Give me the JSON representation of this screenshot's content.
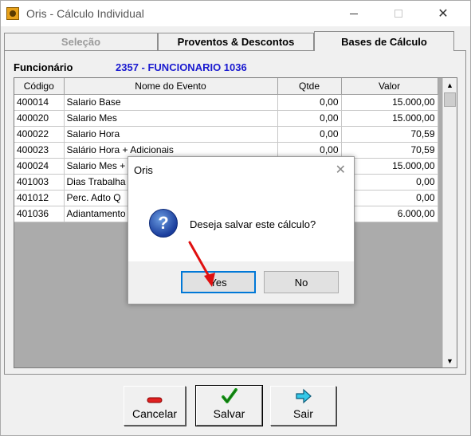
{
  "window": {
    "title": "Oris - Cálculo Individual",
    "close_glyph": "✕"
  },
  "tabs": [
    {
      "label": "Seleção",
      "state": "disabled"
    },
    {
      "label": "Proventos & Descontos",
      "state": "normal"
    },
    {
      "label": "Bases de Cálculo",
      "state": "active"
    }
  ],
  "employee": {
    "label": "Funcionário",
    "value": "2357 - FUNCIONARIO 1036"
  },
  "grid": {
    "columns": [
      "Código",
      "Nome do Evento",
      "Qtde",
      "Valor"
    ],
    "rows": [
      {
        "codigo": "400014",
        "nome": "Salario Base",
        "qtde": "0,00",
        "valor": "15.000,00"
      },
      {
        "codigo": "400020",
        "nome": "Salario Mes",
        "qtde": "0,00",
        "valor": "15.000,00"
      },
      {
        "codigo": "400022",
        "nome": "Salario Hora",
        "qtde": "0,00",
        "valor": "70,59"
      },
      {
        "codigo": "400023",
        "nome": "Salário Hora + Adicionais",
        "qtde": "0,00",
        "valor": "70,59"
      },
      {
        "codigo": "400024",
        "nome": "Salario Mes +",
        "qtde": "",
        "valor": "15.000,00"
      },
      {
        "codigo": "401003",
        "nome": "Dias Trabalha",
        "qtde": "",
        "valor": "0,00"
      },
      {
        "codigo": "401012",
        "nome": "Perc. Adto Q",
        "qtde": "",
        "valor": "0,00"
      },
      {
        "codigo": "401036",
        "nome": "Adiantamento",
        "qtde": "",
        "valor": "6.000,00"
      }
    ]
  },
  "buttons": {
    "cancel": "Cancelar",
    "save": "Salvar",
    "exit": "Sair"
  },
  "dialog": {
    "title": "Oris",
    "message": "Deseja salvar este cálculo?",
    "yes": "Yes",
    "no": "No",
    "close_glyph": "✕",
    "icon_glyph": "?"
  },
  "colors": {
    "employee_value": "#1a1ad0",
    "annotation_arrow": "#e01010"
  }
}
